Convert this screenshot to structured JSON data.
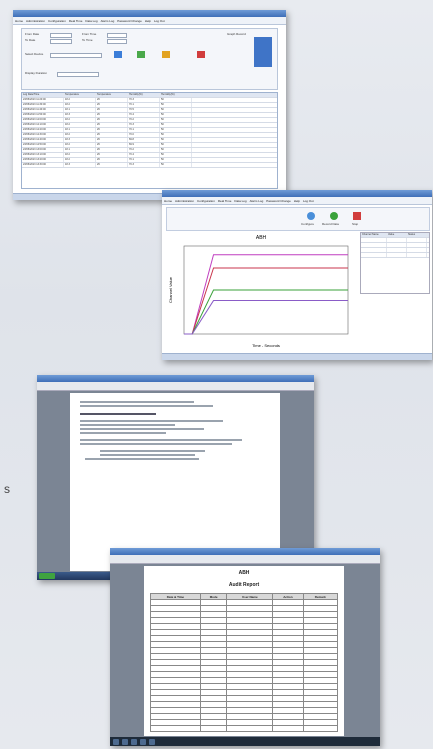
{
  "menu_items": [
    "Home",
    "Administration",
    "Configuration",
    "Real Time",
    "Data Log",
    "Alarm Log",
    "Password Change",
    "Help",
    "Log Out"
  ],
  "screens": {
    "data_log": {
      "form_labels": [
        "From Date",
        "To Date",
        "Select Device",
        "From Time",
        "To Time",
        "Display Duration",
        "Graph Record"
      ],
      "grid_headers": [
        "Log Date/Time",
        "Temperature",
        "Temperature",
        "Humidity(%)",
        "Humidity(%)"
      ],
      "rows": [
        [
          "23/06/2013 11:20:00",
          "18.2",
          "26",
          "70.3",
          "50"
        ],
        [
          "23/06/2013 11:30:00",
          "18.2",
          "26",
          "70.1",
          "50"
        ],
        [
          "23/06/2013 11:40:00",
          "18.1",
          "26",
          "70.5",
          "50"
        ],
        [
          "23/06/2013 11:50:00",
          "18.3",
          "26",
          "70.4",
          "50"
        ],
        [
          "23/06/2013 12:00:00",
          "18.2",
          "26",
          "70.2",
          "50"
        ],
        [
          "23/06/2013 12:10:00",
          "18.2",
          "26",
          "70.3",
          "50"
        ],
        [
          "23/06/2013 12:20:00",
          "18.1",
          "26",
          "70.1",
          "50"
        ],
        [
          "23/06/2013 12:30:00",
          "18.2",
          "26",
          "70.0",
          "50"
        ],
        [
          "23/06/2013 12:40:00",
          "18.3",
          "26",
          "69.8",
          "50"
        ],
        [
          "23/06/2013 12:50:00",
          "18.2",
          "26",
          "69.9",
          "50"
        ],
        [
          "23/06/2013 13:00:00",
          "18.1",
          "26",
          "70.2",
          "50"
        ],
        [
          "23/06/2013 13:10:00",
          "18.2",
          "26",
          "70.4",
          "50"
        ],
        [
          "23/06/2013 13:20:00",
          "18.2",
          "26",
          "70.1",
          "50"
        ],
        [
          "23/06/2013 13:30:00",
          "18.3",
          "26",
          "70.3",
          "50"
        ]
      ]
    },
    "real_time": {
      "chart_title": "ABH",
      "x_axis_label": "Time - Seconds",
      "y_axis_label": "Channel Value",
      "toolbar_labels": [
        "Configure",
        "Record Data",
        "Stop"
      ],
      "side_headers": [
        "Channel Name",
        "Value",
        "Status"
      ]
    },
    "report": {
      "heading": "Audit Report",
      "subheading": "ABH",
      "columns": [
        "Date & Time",
        "Mode",
        "User Name",
        "Action",
        "Remark"
      ]
    }
  },
  "side_label": "s",
  "chart_data": {
    "type": "line",
    "title": "ABH",
    "xlabel": "Time - Seconds",
    "ylabel": "Channel Value",
    "series": [
      {
        "values": [
          0,
          0,
          90,
          90,
          90,
          90,
          90
        ],
        "color": "#c03fc0"
      },
      {
        "values": [
          0,
          0,
          75,
          75,
          75,
          75,
          75
        ],
        "color": "#c9364c"
      },
      {
        "values": [
          0,
          0,
          50,
          50,
          50,
          50,
          50
        ],
        "color": "#3aa23a"
      },
      {
        "values": [
          0,
          0,
          38,
          38,
          38,
          38,
          38
        ],
        "color": "#8a5cc7"
      }
    ],
    "ylim": [
      0,
      100
    ]
  }
}
